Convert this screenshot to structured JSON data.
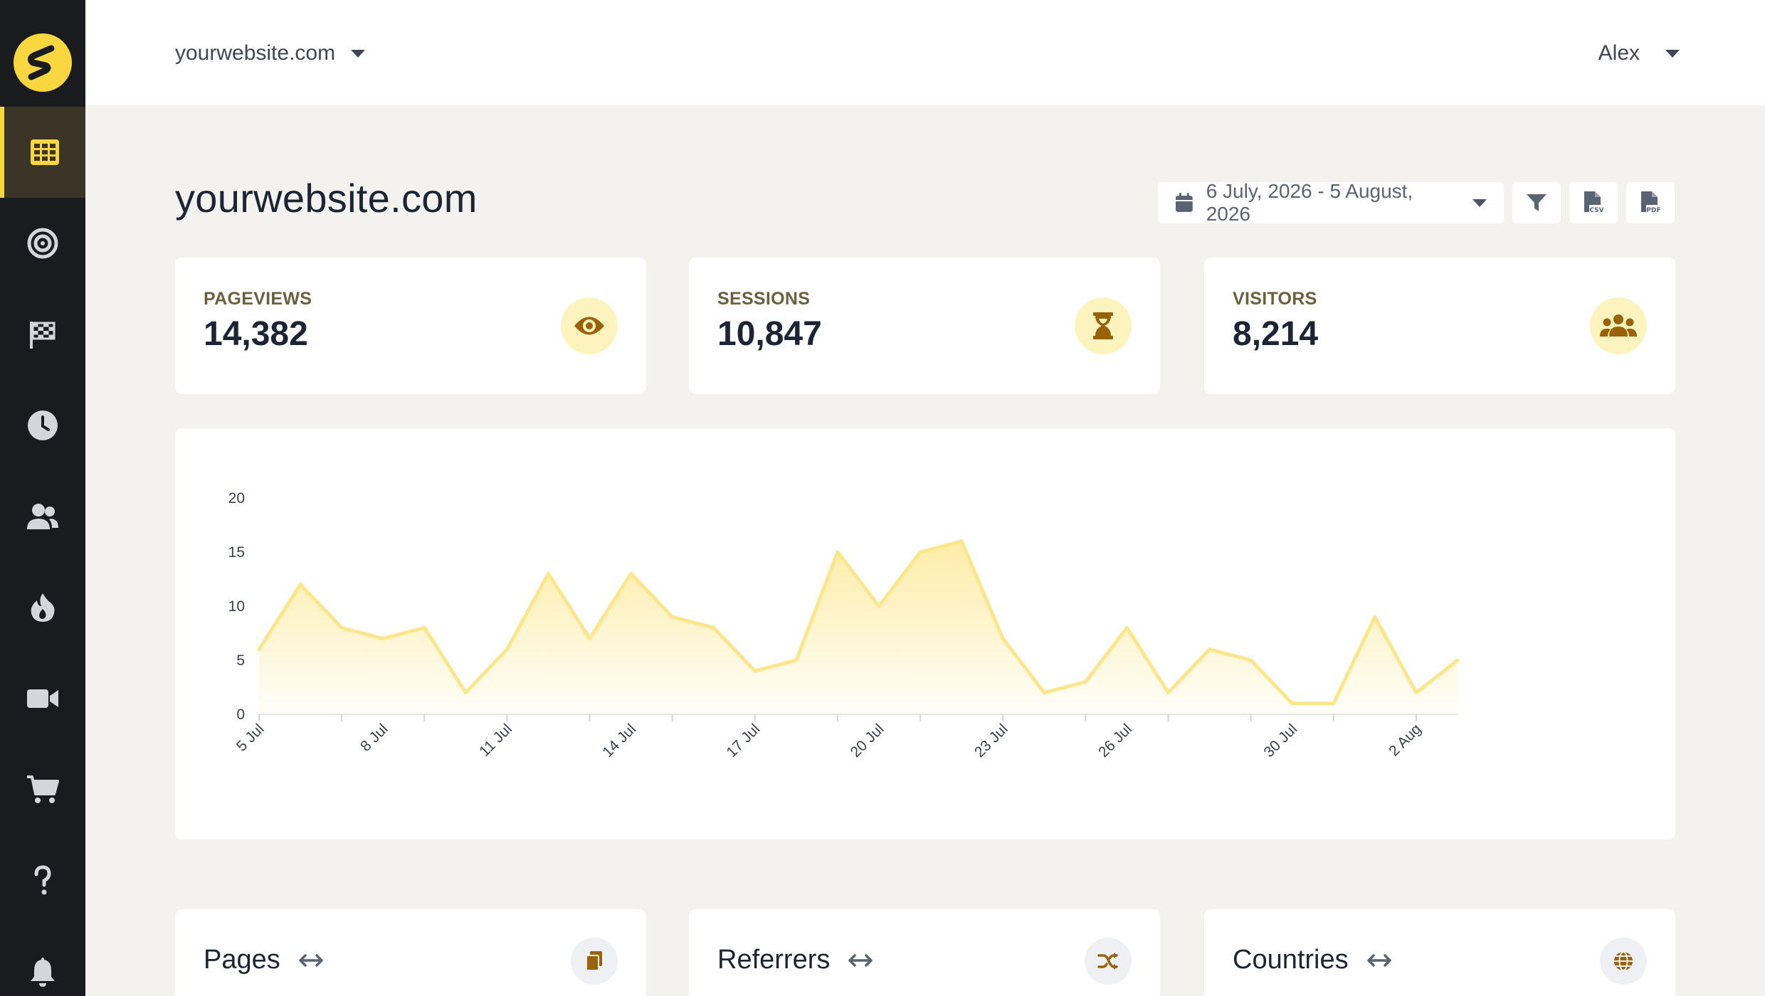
{
  "app": {
    "logo_letter": "S"
  },
  "topbar": {
    "site": "yourwebsite.com",
    "user": "Alex"
  },
  "sidebar": {
    "items": [
      {
        "icon": "dashboard-grid-icon",
        "active": true
      },
      {
        "icon": "target-icon",
        "active": false
      },
      {
        "icon": "checkered-flag-icon",
        "active": false
      },
      {
        "icon": "clock-icon",
        "active": false
      },
      {
        "icon": "users-icon",
        "active": false
      },
      {
        "icon": "fire-icon",
        "active": false
      },
      {
        "icon": "video-camera-icon",
        "active": false
      },
      {
        "icon": "cart-icon",
        "active": false
      },
      {
        "icon": "question-icon",
        "active": false
      },
      {
        "icon": "bell-icon",
        "active": false
      }
    ]
  },
  "page": {
    "title": "yourwebsite.com",
    "date_range": "6 July, 2026 - 5 August, 2026",
    "export_csv": "CSV",
    "export_pdf": "PDF"
  },
  "stats": [
    {
      "label": "PAGEVIEWS",
      "value": "14,382",
      "icon": "eye-icon"
    },
    {
      "label": "SESSIONS",
      "value": "10,847",
      "icon": "hourglass-icon"
    },
    {
      "label": "VISITORS",
      "value": "8,214",
      "icon": "user-group-icon"
    }
  ],
  "colors": {
    "accent": "#f7d640",
    "sidebar_bg": "#1a1b1e",
    "line": "#fde68a",
    "icon_brown": "#9a6208"
  },
  "chart_data": {
    "type": "area",
    "x": [
      "5 Jul",
      "6 Jul",
      "7 Jul",
      "8 Jul",
      "9 Jul",
      "10 Jul",
      "11 Jul",
      "12 Jul",
      "13 Jul",
      "14 Jul",
      "15 Jul",
      "16 Jul",
      "17 Jul",
      "18 Jul",
      "19 Jul",
      "20 Jul",
      "21 Jul",
      "22 Jul",
      "23 Jul",
      "24 Jul",
      "25 Jul",
      "26 Jul",
      "27 Jul",
      "28 Jul",
      "29 Jul",
      "30 Jul",
      "31 Jul",
      "1 Aug",
      "2 Aug",
      "3 Aug"
    ],
    "values": [
      6,
      12,
      8,
      7,
      8,
      2,
      6,
      13,
      7,
      13,
      9,
      8,
      4,
      5,
      15,
      10,
      15,
      16,
      7,
      2,
      3,
      8,
      2,
      6,
      5,
      1,
      1,
      9,
      2,
      5
    ],
    "tick_labels": [
      "5 Jul",
      "8 Jul",
      "11 Jul",
      "14 Jul",
      "17 Jul",
      "20 Jul",
      "23 Jul",
      "26 Jul",
      "30 Jul",
      "2 Aug"
    ],
    "tick_indices": [
      0,
      3,
      6,
      9,
      12,
      15,
      18,
      21,
      25,
      28
    ],
    "yticks": [
      0,
      5,
      10,
      15,
      20
    ],
    "ylim": [
      0,
      20
    ],
    "grid": false
  },
  "panels": [
    {
      "title": "Pages",
      "icon": "copy-icon"
    },
    {
      "title": "Referrers",
      "icon": "shuffle-icon"
    },
    {
      "title": "Countries",
      "icon": "globe-icon"
    }
  ]
}
